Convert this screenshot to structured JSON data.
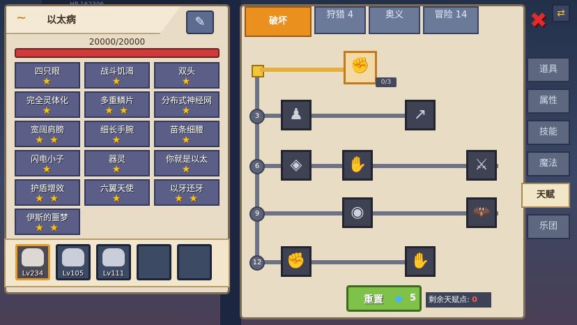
{
  "hp_strip": "HP 162306",
  "character": {
    "name": "以太病",
    "hp": "20000/20000"
  },
  "talents": [
    {
      "label": "四只眼",
      "stars": "★"
    },
    {
      "label": "战斗饥渴",
      "stars": "★"
    },
    {
      "label": "双头",
      "stars": "★"
    },
    {
      "label": "完全灵体化",
      "stars": "★"
    },
    {
      "label": "多重鳞片",
      "stars": "★ ★"
    },
    {
      "label": "分布式神经网",
      "stars": "★"
    },
    {
      "label": "宽阔肩膀",
      "stars": "★ ★"
    },
    {
      "label": "细长手腕",
      "stars": "★"
    },
    {
      "label": "苗条细腰",
      "stars": "★"
    },
    {
      "label": "闪电小子",
      "stars": "★"
    },
    {
      "label": "器灵",
      "stars": "★"
    },
    {
      "label": "你就是以太",
      "stars": "★"
    },
    {
      "label": "护盾增效",
      "stars": "★ ★"
    },
    {
      "label": "六翼天使",
      "stars": "★"
    },
    {
      "label": "以牙还牙",
      "stars": "★ ★"
    },
    {
      "label": "伊斯的噩梦",
      "stars": "★ ★"
    }
  ],
  "party": [
    {
      "level": "Lv234",
      "selected": true
    },
    {
      "level": "Lv105",
      "selected": false
    },
    {
      "level": "Lv111",
      "selected": false
    },
    {
      "level": "",
      "selected": false
    },
    {
      "level": "",
      "selected": false
    }
  ],
  "tabs": [
    {
      "label": "破坏",
      "active": true
    },
    {
      "label": "狩猎 4",
      "active": false
    },
    {
      "label": "奥义",
      "active": false
    },
    {
      "label": "冒险 14",
      "active": false
    }
  ],
  "tree": {
    "levels": [
      "3",
      "6",
      "9",
      "12"
    ],
    "top_skill_count": "0/3",
    "icons": {
      "top": "arm-wrestle-icon",
      "r3a": "muscle-man-icon",
      "r3b": "swap-arrow-icon",
      "r6a": "shield-slash-icon",
      "r6b": "punch-icon",
      "r6c": "blade-icon",
      "r9a": "ring-icon",
      "r9b": "bat-wings-icon",
      "r12a": "fist-icon",
      "r12b": "gauntlet-icon"
    }
  },
  "reset": {
    "label": "重置",
    "cost": "5"
  },
  "remaining": {
    "label": "剩余天赋点:",
    "value": "0"
  },
  "sidebar": [
    "道具",
    "属性",
    "技能",
    "魔法",
    "天赋",
    "乐团"
  ],
  "sidebar_active": "天赋"
}
